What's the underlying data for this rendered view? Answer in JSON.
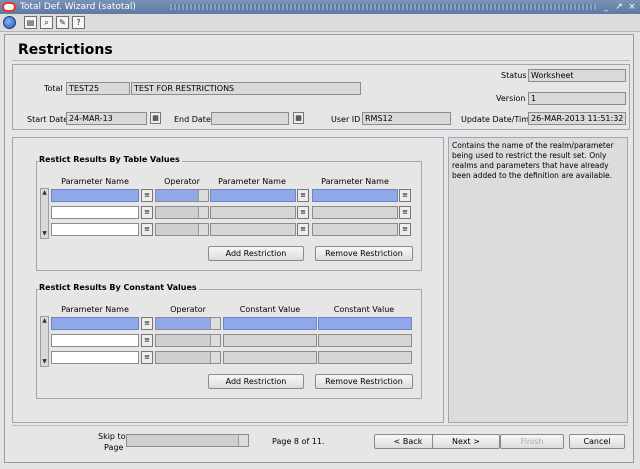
{
  "window": {
    "title": "Total Def. Wizard  (satotal)",
    "controls": [
      "_",
      "↗",
      "×"
    ]
  },
  "toolbar": {
    "icons": [
      "globe-icon",
      "save-icon",
      "find-icon",
      "edit-icon",
      "help-icon"
    ],
    "help_glyph": "?"
  },
  "page": {
    "title": "Restrictions"
  },
  "header": {
    "total_label": "Total",
    "total_code": "TEST25",
    "total_desc": "TEST FOR RESTRICTIONS",
    "status_label": "Status",
    "status_value": "Worksheet",
    "version_label": "Version",
    "version_value": "1",
    "start_date_label": "Start Date",
    "start_date_value": "24-MAR-13",
    "end_date_label": "End Date",
    "end_date_value": "",
    "user_id_label": "User ID",
    "user_id_value": "RMS12",
    "update_label": "Update Date/Time",
    "update_value": "26-MAR-2013 11:51:32"
  },
  "table_values": {
    "title": "Restict Results By Table Values",
    "columns": [
      "Parameter Name",
      "Operator",
      "Parameter Name",
      "Parameter Name"
    ],
    "add_button": "Add Restriction",
    "remove_button": "Remove Restriction"
  },
  "constant_values": {
    "title": "Restict Results By Constant Values",
    "columns": [
      "Parameter Name",
      "Operator",
      "Constant Value",
      "Constant Value"
    ],
    "add_button": "Add Restriction",
    "remove_button": "Remove Restriction"
  },
  "help": {
    "text": "Contains the name of the realm/parameter being used to restrict the result set.  Only realms and parameters that have already been added to the definition are available."
  },
  "footer": {
    "skip_label_1": "Skip to",
    "skip_label_2": "Page",
    "page_info": "Page 8 of 11.",
    "back_button": "< Back",
    "next_button": "Next >",
    "finish_button": "Finish",
    "cancel_button": "Cancel"
  }
}
